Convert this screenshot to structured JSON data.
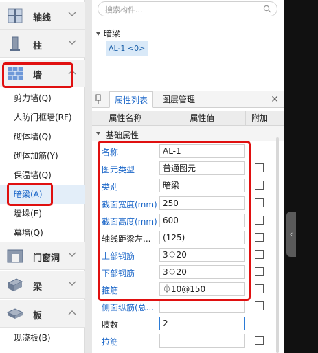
{
  "nav": {
    "categories": [
      {
        "label": "轴线",
        "icon": "grid-axis-icon",
        "expanded": false
      },
      {
        "label": "柱",
        "icon": "column-icon",
        "expanded": false
      },
      {
        "label": "墙",
        "icon": "wall-icon",
        "expanded": true
      },
      {
        "label": "门窗洞",
        "icon": "door-window-icon",
        "expanded": false
      },
      {
        "label": "梁",
        "icon": "beam-icon",
        "expanded": false
      },
      {
        "label": "板",
        "icon": "slab-icon",
        "expanded": true
      }
    ],
    "wall_items": [
      "剪力墙(Q)",
      "人防门框墙(RF)",
      "砌体墙(Q)",
      "砌体加筋(Y)",
      "保温墙(Q)",
      "暗梁(A)",
      "墙垛(E)",
      "幕墙(Q)"
    ],
    "slab_items": [
      "现浇板(B)"
    ],
    "active_item": "暗梁(A)"
  },
  "search": {
    "placeholder": "搜索构件..."
  },
  "tree": {
    "root": "暗梁",
    "node": "AL-1 <0>"
  },
  "tabs": {
    "properties": "属性列表",
    "layers": "图层管理"
  },
  "table": {
    "col_name": "属性名称",
    "col_value": "属性值",
    "col_extra": "附加",
    "group": "基础属性",
    "rows": [
      {
        "name": "名称",
        "value": "AL-1",
        "blue": true,
        "checkbox": false
      },
      {
        "name": "图元类型",
        "value": "普通图元",
        "blue": true,
        "checkbox": true
      },
      {
        "name": "类别",
        "value": "暗梁",
        "blue": true,
        "checkbox": true
      },
      {
        "name": "截面宽度(mm)",
        "value": "250",
        "blue": true,
        "checkbox": true
      },
      {
        "name": "截面高度(mm)",
        "value": "600",
        "blue": true,
        "checkbox": true
      },
      {
        "name": "轴线距梁左...",
        "value": "(125)",
        "blue": false,
        "checkbox": true
      },
      {
        "name": "上部钢筋",
        "value": "3⏀20",
        "blue": true,
        "checkbox": true
      },
      {
        "name": "下部钢筋",
        "value": "3⏀20",
        "blue": true,
        "checkbox": true
      },
      {
        "name": "箍筋",
        "value": "⏀10@150",
        "blue": true,
        "checkbox": true
      },
      {
        "name": "侧面纵筋(总...",
        "value": "",
        "blue": true,
        "checkbox": true
      },
      {
        "name": "肢数",
        "value": "2",
        "blue": false,
        "checkbox": false
      },
      {
        "name": "拉筋",
        "value": "",
        "blue": true,
        "checkbox": true
      }
    ]
  },
  "colors": {
    "accent": "#1a66c8",
    "highlight": "#e01010"
  }
}
